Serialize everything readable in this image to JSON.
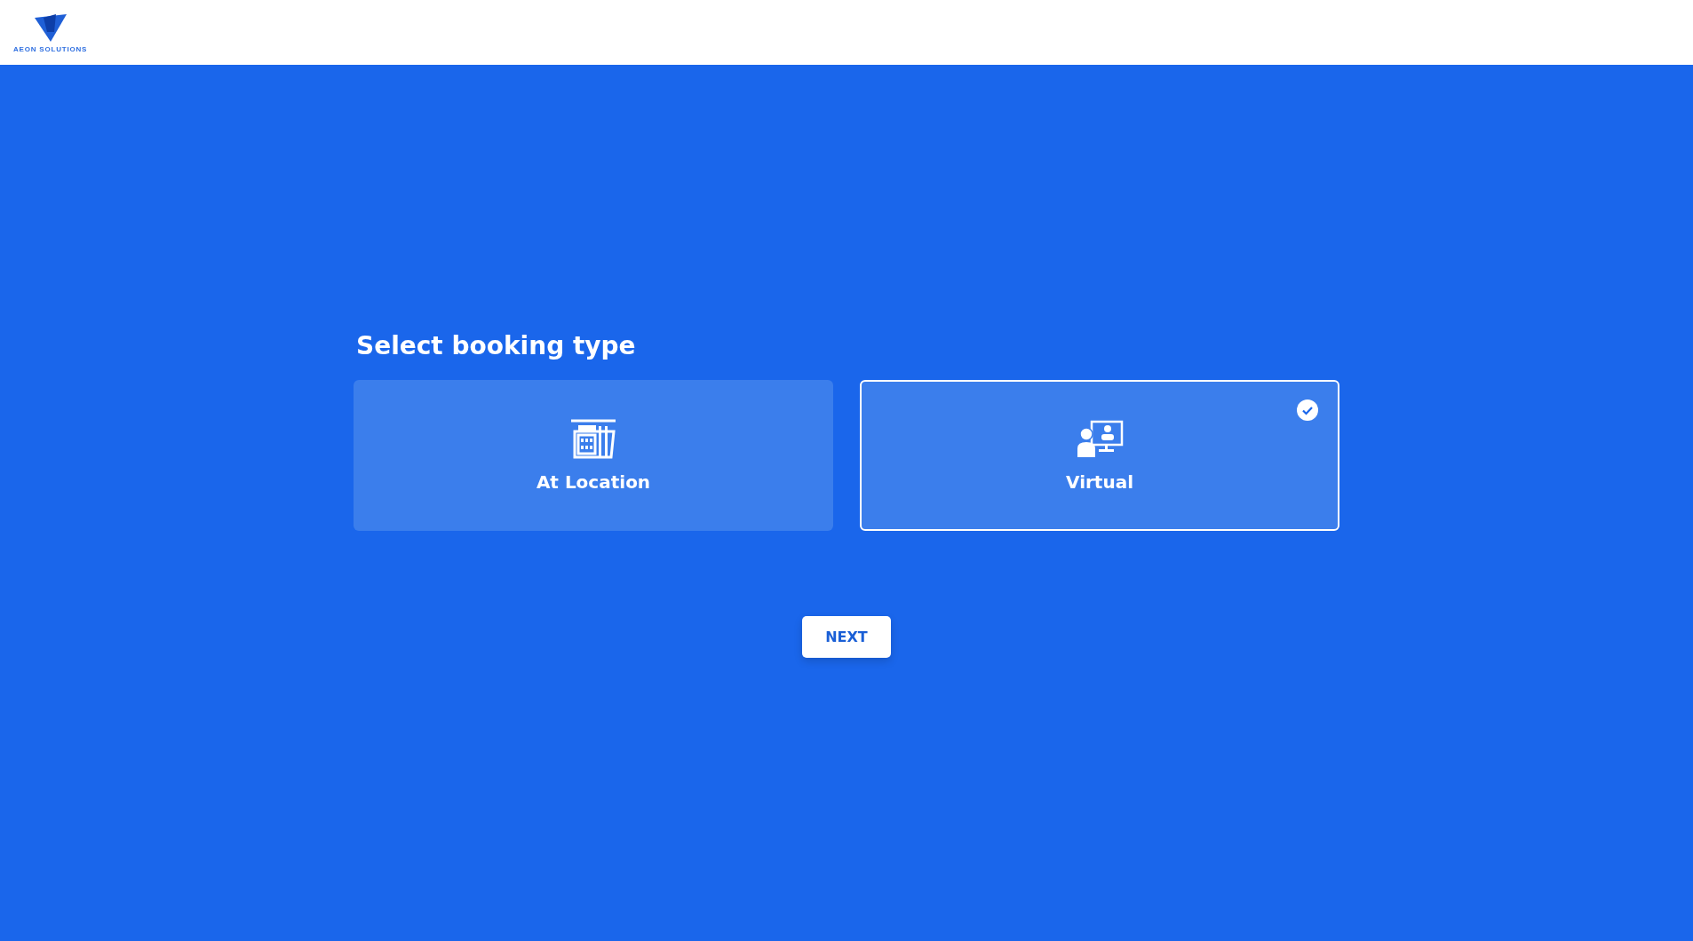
{
  "header": {
    "logo_text": "AEON SOLUTIONS"
  },
  "title": "Select booking type",
  "options": [
    {
      "kind": "building",
      "label": "At Location",
      "selected": false
    },
    {
      "kind": "video-call",
      "label": "Virtual",
      "selected": true
    }
  ],
  "next_button": "NEXT"
}
